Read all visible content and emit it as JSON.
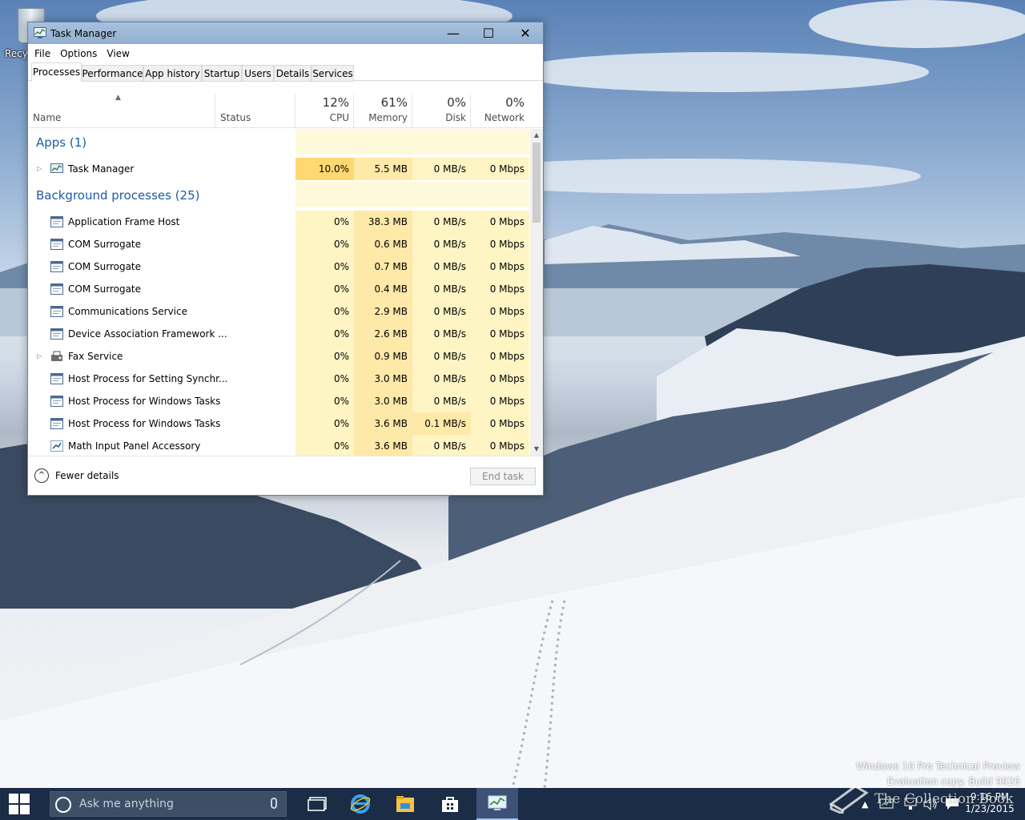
{
  "desktop": {
    "recycle_label": "Recy",
    "watermark_line1": "Windows 10 Pro Technical Preview",
    "watermark_line2": "Evaluation copy. Build 9926",
    "brand_text": "The Collection Book"
  },
  "window": {
    "title": "Task Manager",
    "minimize": "—",
    "maximize": "☐",
    "close": "✕"
  },
  "menu": [
    "File",
    "Options",
    "View"
  ],
  "tabs": [
    "Processes",
    "Performance",
    "App history",
    "Startup",
    "Users",
    "Details",
    "Services"
  ],
  "columns": {
    "name": "Name",
    "status": "Status",
    "cpu": {
      "pct": "12%",
      "label": "CPU"
    },
    "memory": {
      "pct": "61%",
      "label": "Memory"
    },
    "disk": {
      "pct": "0%",
      "label": "Disk"
    },
    "network": {
      "pct": "0%",
      "label": "Network"
    }
  },
  "groups": {
    "apps": "Apps (1)",
    "background": "Background processes (25)"
  },
  "apps": [
    {
      "name": "Task Manager",
      "cpu": "10.0%",
      "mem": "5.5 MB",
      "disk": "0 MB/s",
      "net": "0 Mbps"
    }
  ],
  "processes": [
    {
      "name": "Application Frame Host",
      "cpu": "0%",
      "mem": "38.3 MB",
      "disk": "0 MB/s",
      "net": "0 Mbps"
    },
    {
      "name": "COM Surrogate",
      "cpu": "0%",
      "mem": "0.6 MB",
      "disk": "0 MB/s",
      "net": "0 Mbps"
    },
    {
      "name": "COM Surrogate",
      "cpu": "0%",
      "mem": "0.7 MB",
      "disk": "0 MB/s",
      "net": "0 Mbps"
    },
    {
      "name": "COM Surrogate",
      "cpu": "0%",
      "mem": "0.4 MB",
      "disk": "0 MB/s",
      "net": "0 Mbps"
    },
    {
      "name": "Communications Service",
      "cpu": "0%",
      "mem": "2.9 MB",
      "disk": "0 MB/s",
      "net": "0 Mbps"
    },
    {
      "name": "Device Association Framework ...",
      "cpu": "0%",
      "mem": "2.6 MB",
      "disk": "0 MB/s",
      "net": "0 Mbps"
    },
    {
      "name": "Fax Service",
      "cpu": "0%",
      "mem": "0.9 MB",
      "disk": "0 MB/s",
      "net": "0 Mbps"
    },
    {
      "name": "Host Process for Setting Synchr...",
      "cpu": "0%",
      "mem": "3.0 MB",
      "disk": "0 MB/s",
      "net": "0 Mbps"
    },
    {
      "name": "Host Process for Windows Tasks",
      "cpu": "0%",
      "mem": "3.0 MB",
      "disk": "0 MB/s",
      "net": "0 Mbps"
    },
    {
      "name": "Host Process for Windows Tasks",
      "cpu": "0%",
      "mem": "3.6 MB",
      "disk": "0.1 MB/s",
      "net": "0 Mbps"
    },
    {
      "name": "Math Input Panel Accessory",
      "cpu": "0%",
      "mem": "3.6 MB",
      "disk": "0 MB/s",
      "net": "0 Mbps"
    }
  ],
  "footer": {
    "fewer_details": "Fewer details",
    "end_task": "End task"
  },
  "taskbar": {
    "search_placeholder": "Ask me anything",
    "time": "9:16 PM",
    "date": "1/23/2015"
  }
}
